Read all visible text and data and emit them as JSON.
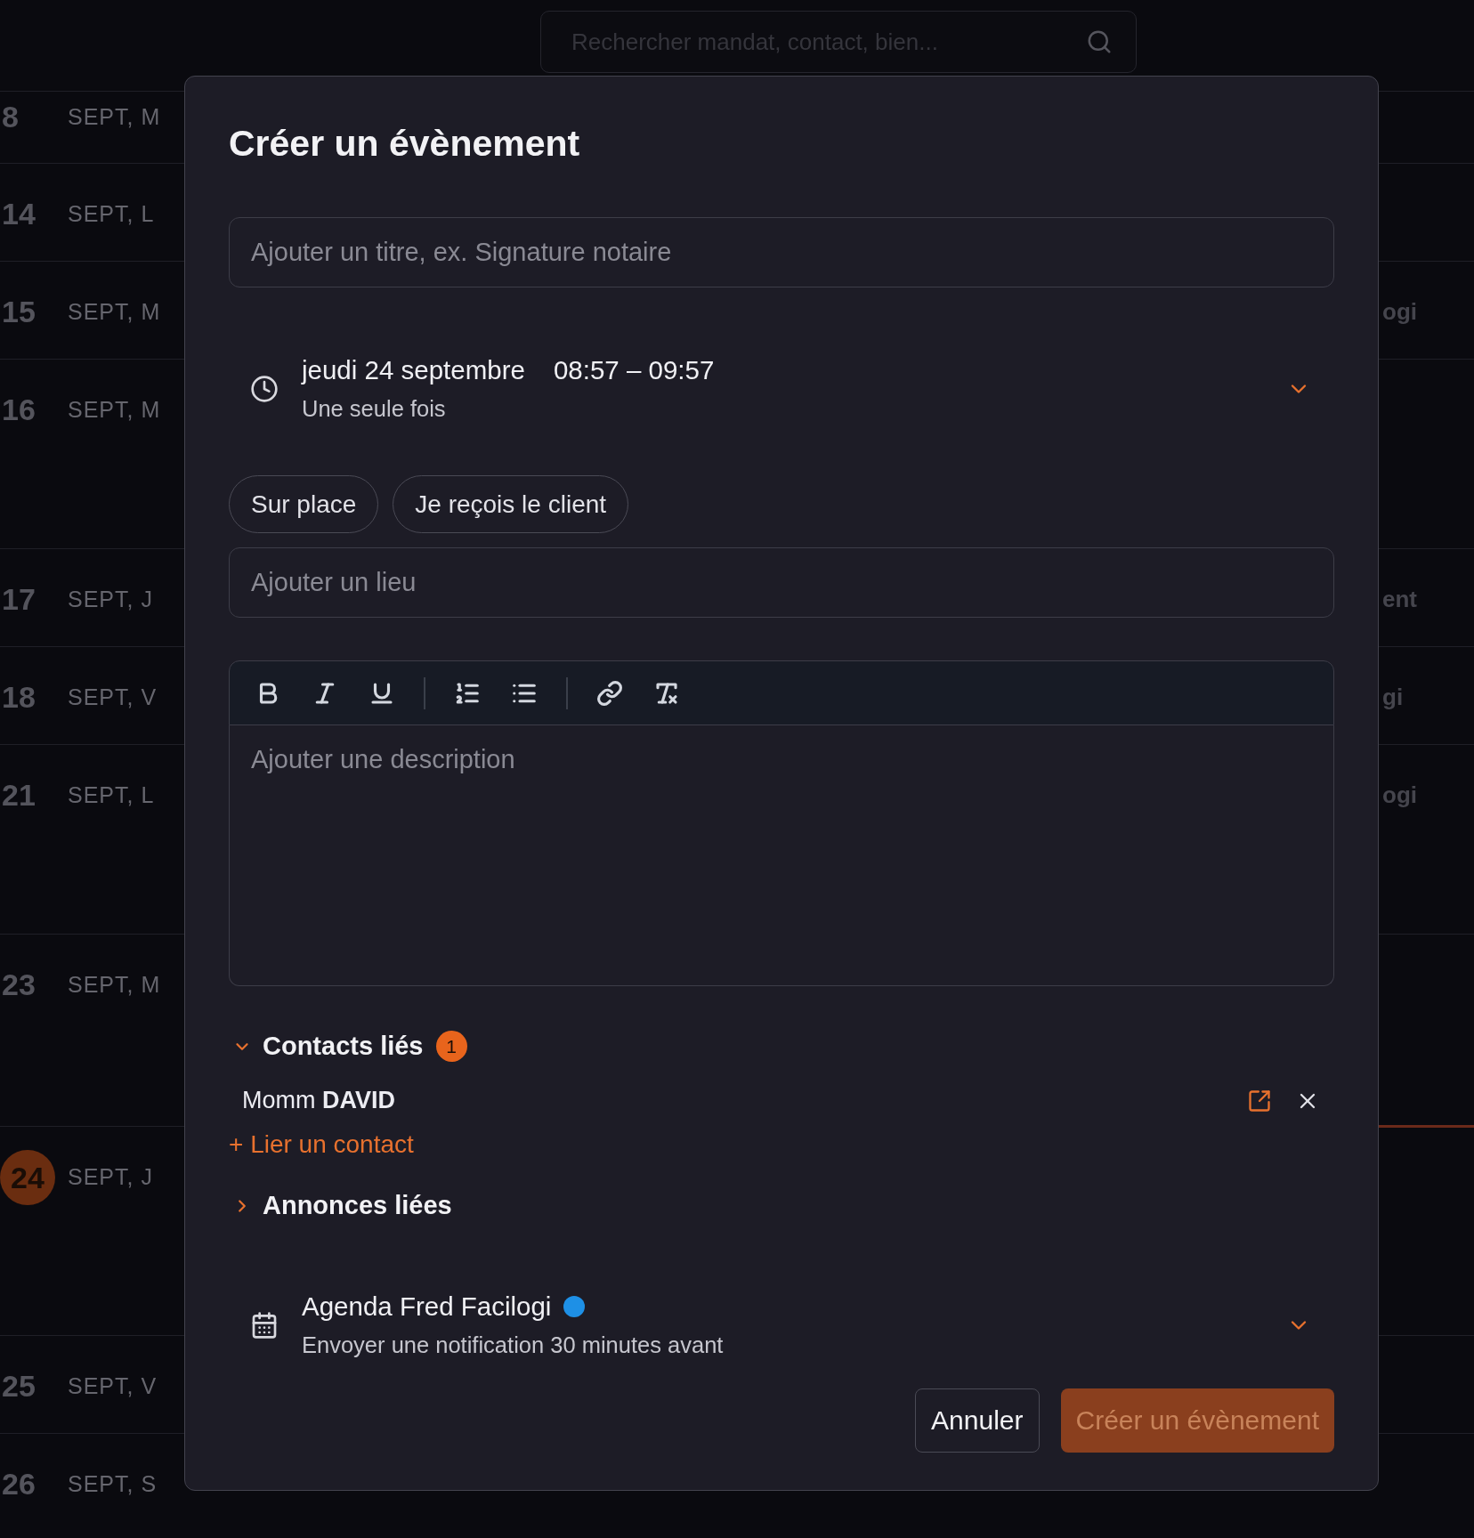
{
  "search": {
    "placeholder": "Rechercher mandat, contact, bien..."
  },
  "days": [
    {
      "day": "8",
      "label": "SEPT, M",
      "current": false
    },
    {
      "day": "14",
      "label": "SEPT, L",
      "current": false
    },
    {
      "day": "15",
      "label": "SEPT, M",
      "note": "ogi",
      "current": false
    },
    {
      "day": "16",
      "label": "SEPT, M",
      "current": false
    },
    {
      "day": "17",
      "label": "SEPT, J",
      "note": "ent",
      "current": false
    },
    {
      "day": "18",
      "label": "SEPT, V",
      "note": "gi",
      "current": false
    },
    {
      "day": "21",
      "label": "SEPT, L",
      "note": "ogi",
      "current": false
    },
    {
      "day": "23",
      "label": "SEPT, M",
      "current": false
    },
    {
      "day": "24",
      "label": "SEPT, J",
      "current": true
    },
    {
      "day": "25",
      "label": "SEPT, V",
      "current": false
    },
    {
      "day": "26",
      "label": "SEPT, S",
      "current": false
    }
  ],
  "dialog": {
    "title": "Créer un évènement",
    "title_field": {
      "placeholder": "Ajouter un titre, ex. Signature notaire"
    },
    "when": {
      "date": "jeudi 24 septembre",
      "time": "08:57 – 09:57",
      "recurrence": "Une seule fois"
    },
    "chips": [
      {
        "label": "Sur place",
        "selected": false
      },
      {
        "label": "Je reçois le client",
        "selected": false
      }
    ],
    "place_field": {
      "placeholder": "Ajouter un lieu"
    },
    "editor": {
      "placeholder": "Ajouter une description"
    },
    "contacts": {
      "title": "Contacts liés",
      "count": "1",
      "expanded": true,
      "items": [
        {
          "first": "Momm",
          "last": "DAVID"
        }
      ],
      "add_link": "+ Lier un contact"
    },
    "listings": {
      "title": "Annonces liées",
      "expanded": false
    },
    "calendar": {
      "name": "Agenda Fred Facilogi",
      "color": "#1e90e6",
      "notification": "Envoyer une notification 30 minutes avant"
    },
    "buttons": [
      {
        "label": "Annuler",
        "kind": "secondary",
        "disabled": false
      },
      {
        "label": "Créer un évènement",
        "kind": "primary",
        "disabled": true
      }
    ]
  }
}
